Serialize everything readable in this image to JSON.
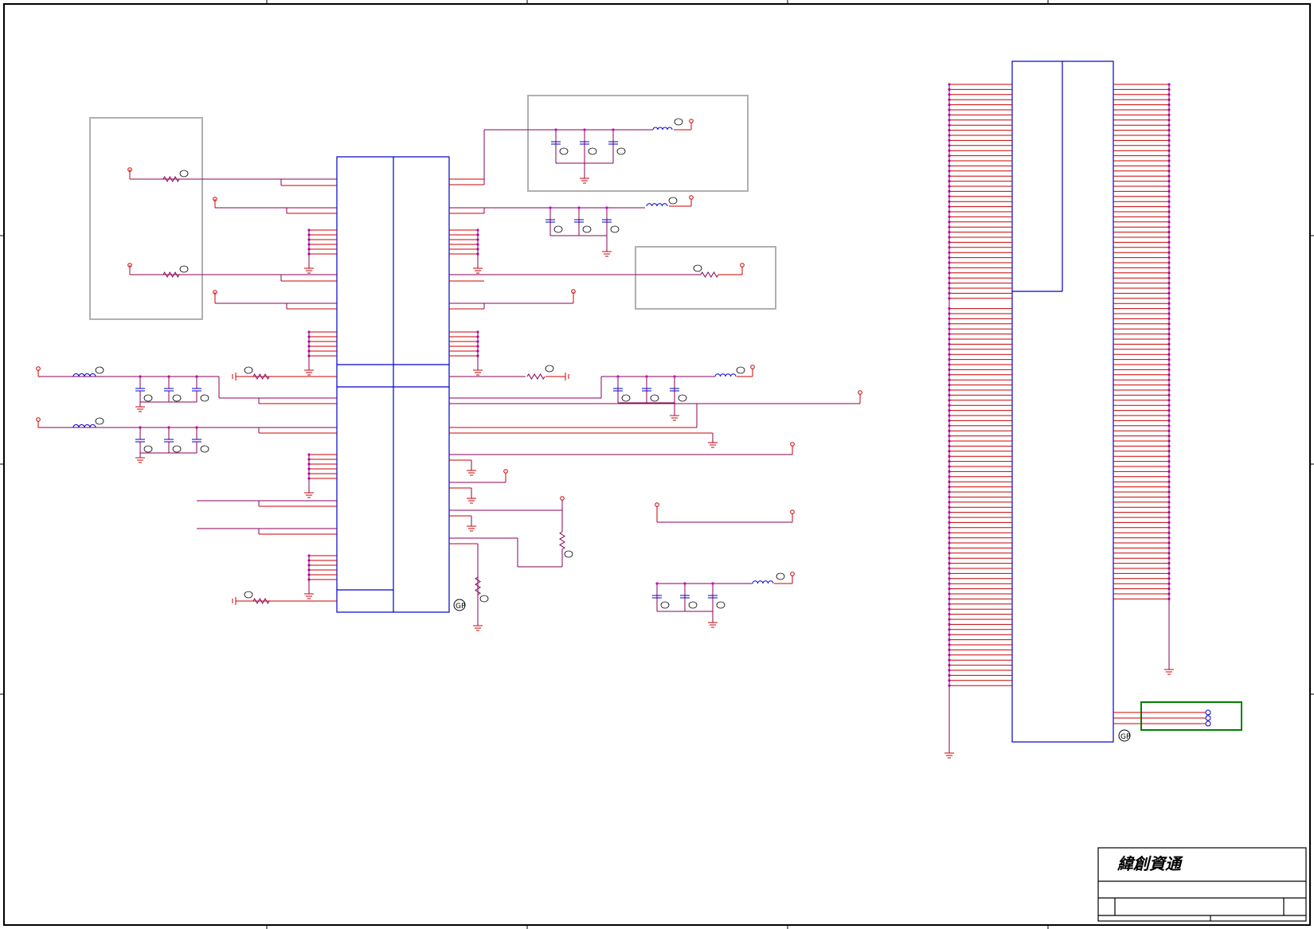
{
  "title_block": {
    "company": "緯創資通"
  },
  "part_markers": {
    "gp_main": "GP",
    "gp_connector": "GP"
  },
  "colors": {
    "wire": "#cc0000",
    "net": "#8b005a",
    "component_box": "#0000cc",
    "group_box": "#b0b0b0",
    "connector_box": "#008000",
    "frame": "#000000"
  }
}
